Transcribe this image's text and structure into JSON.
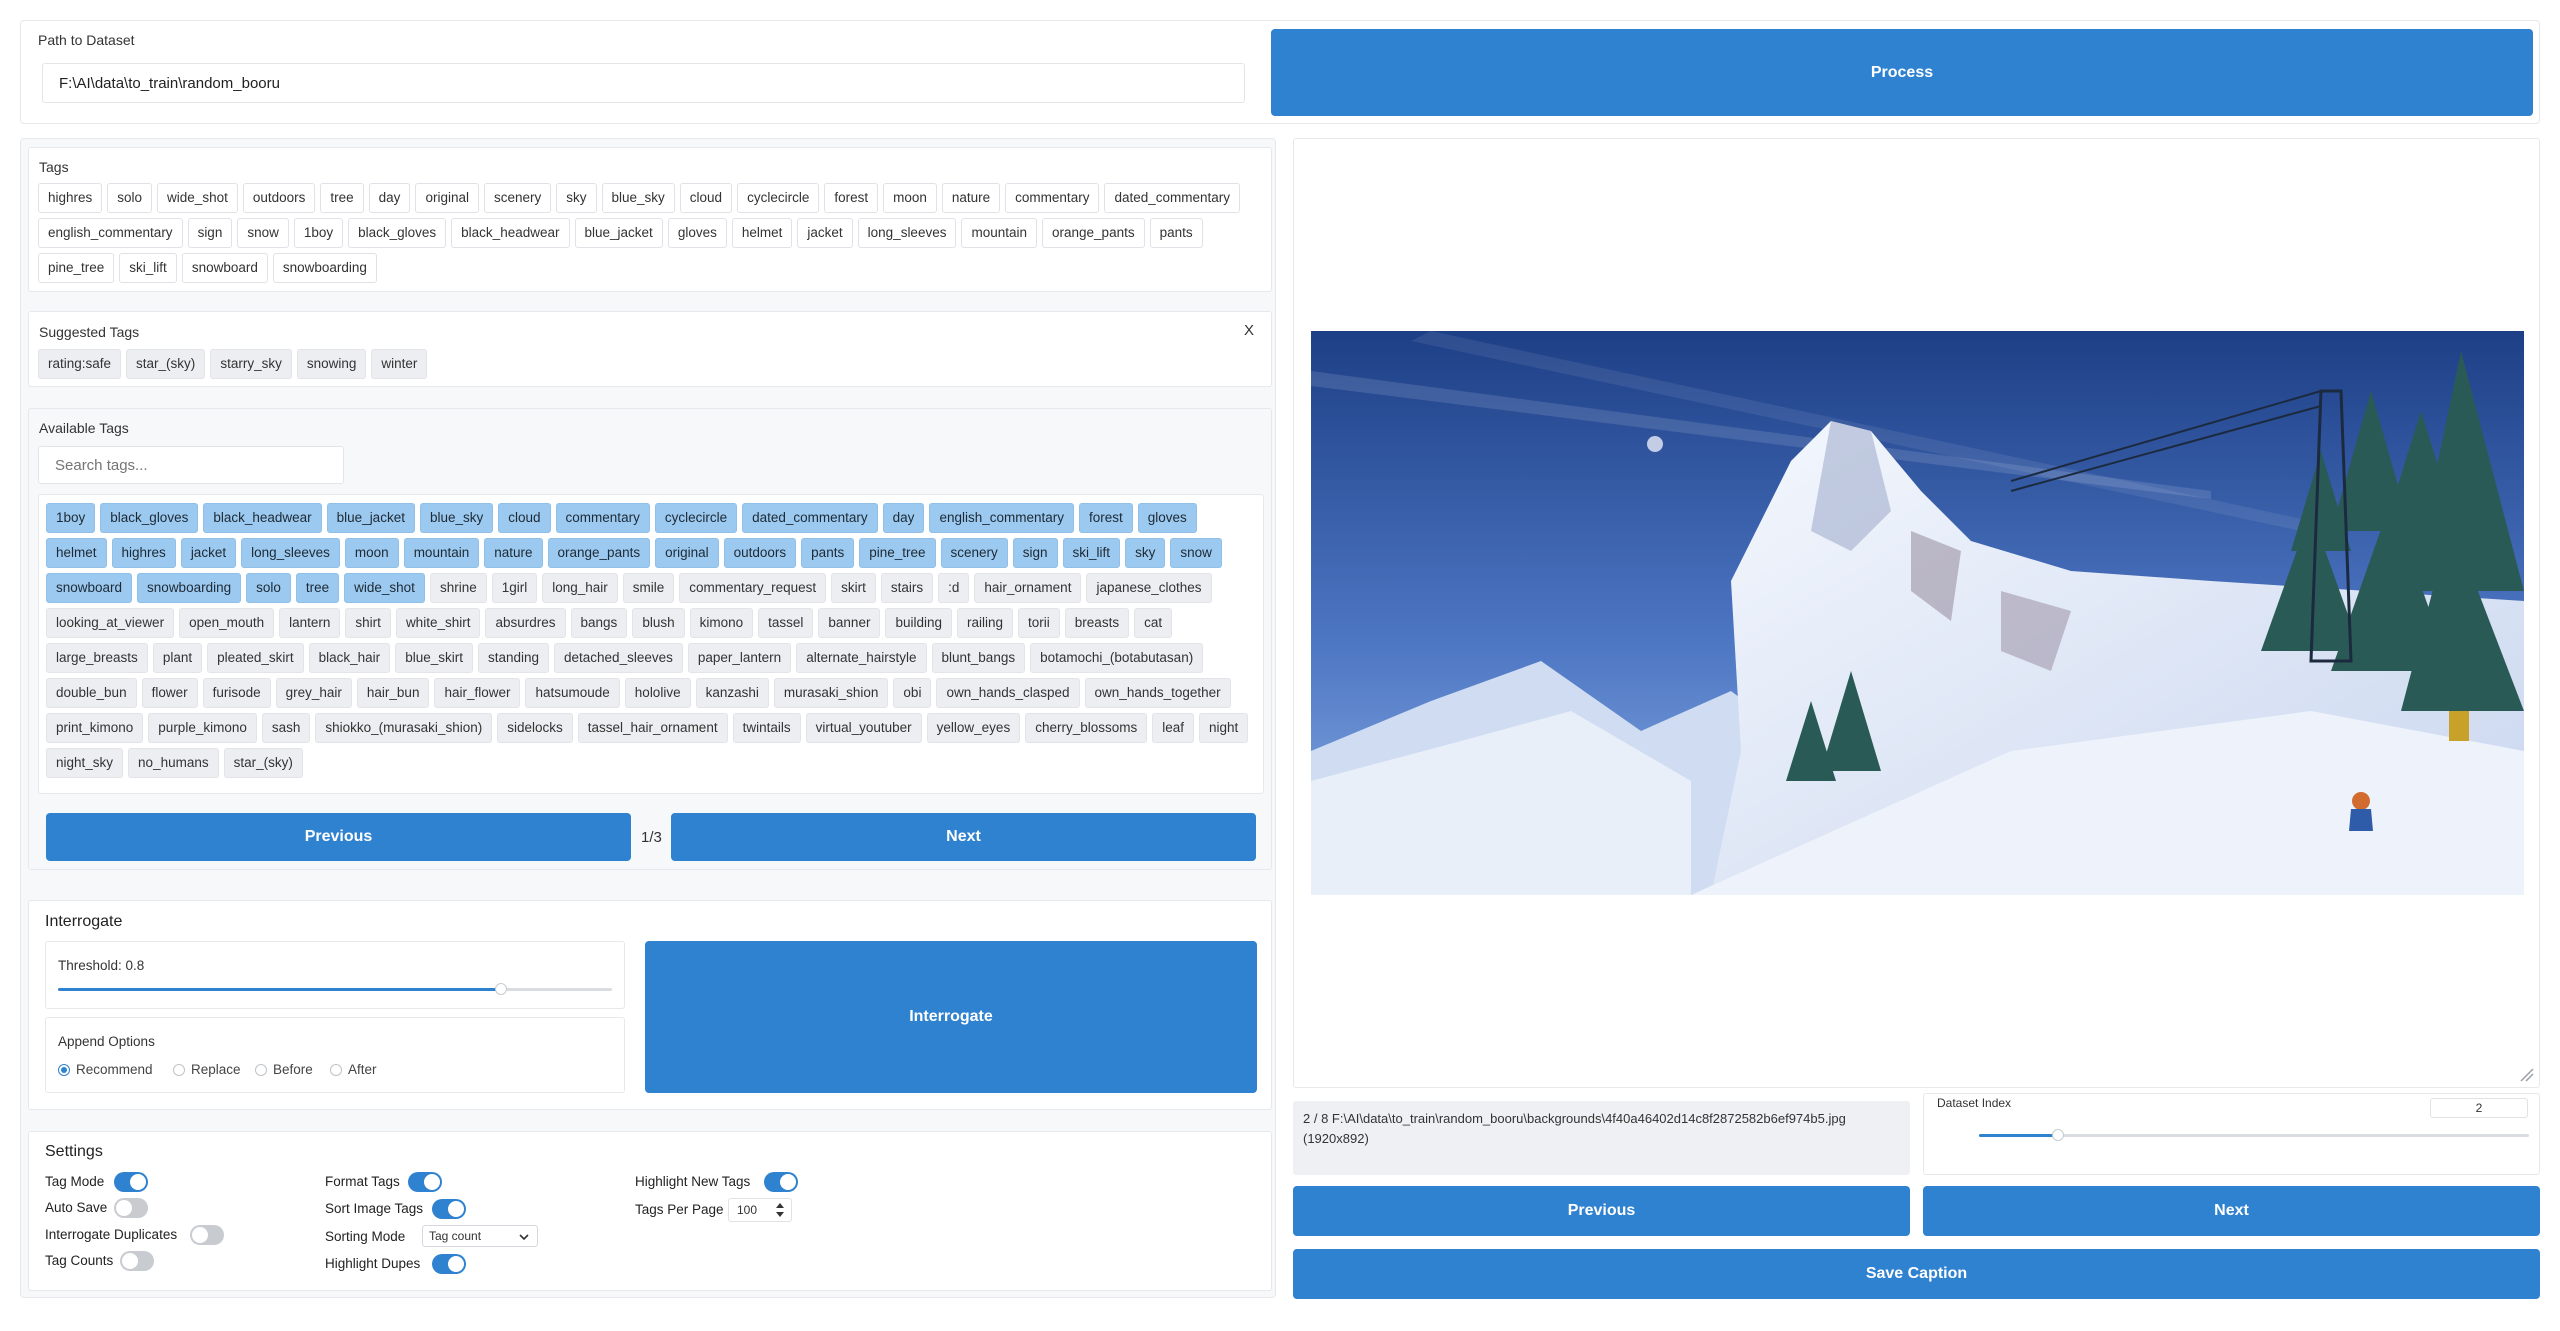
{
  "dataset": {
    "path_label": "Path to Dataset",
    "path_value": "F:\\AI\\data\\to_train\\random_booru",
    "process_label": "Process"
  },
  "tags": {
    "heading": "Tags",
    "items": [
      "highres",
      "solo",
      "wide_shot",
      "outdoors",
      "tree",
      "day",
      "original",
      "scenery",
      "sky",
      "blue_sky",
      "cloud",
      "cyclecircle",
      "forest",
      "moon",
      "nature",
      "commentary",
      "dated_commentary",
      "english_commentary",
      "sign",
      "snow",
      "1boy",
      "black_gloves",
      "black_headwear",
      "blue_jacket",
      "gloves",
      "helmet",
      "jacket",
      "long_sleeves",
      "mountain",
      "orange_pants",
      "pants",
      "pine_tree",
      "ski_lift",
      "snowboard",
      "snowboarding"
    ]
  },
  "suggested": {
    "heading": "Suggested Tags",
    "close_label": "X",
    "items": [
      "rating:safe",
      "star_(sky)",
      "starry_sky",
      "snowing",
      "winter"
    ]
  },
  "available": {
    "heading": "Available Tags",
    "search_placeholder": "Search tags...",
    "selected_items": [
      "1boy",
      "black_gloves",
      "black_headwear",
      "blue_jacket",
      "blue_sky",
      "cloud",
      "commentary",
      "cyclecircle",
      "dated_commentary",
      "day",
      "english_commentary",
      "forest",
      "gloves",
      "helmet",
      "highres",
      "jacket",
      "long_sleeves",
      "moon",
      "mountain",
      "nature",
      "orange_pants",
      "original",
      "outdoors",
      "pants",
      "pine_tree",
      "scenery",
      "sign",
      "ski_lift",
      "sky",
      "snow",
      "snowboard",
      "snowboarding",
      "solo",
      "tree",
      "wide_shot"
    ],
    "other_items": [
      "shrine",
      "1girl",
      "long_hair",
      "smile",
      "commentary_request",
      "skirt",
      "stairs",
      ":d",
      "hair_ornament",
      "japanese_clothes",
      "looking_at_viewer",
      "open_mouth",
      "lantern",
      "shirt",
      "white_shirt",
      "absurdres",
      "bangs",
      "blush",
      "kimono",
      "tassel",
      "banner",
      "building",
      "railing",
      "torii",
      "breasts",
      "cat",
      "large_breasts",
      "plant",
      "pleated_skirt",
      "black_hair",
      "blue_skirt",
      "standing",
      "detached_sleeves",
      "paper_lantern",
      "alternate_hairstyle",
      "blunt_bangs",
      "botamochi_(botabutasan)",
      "double_bun",
      "flower",
      "furisode",
      "grey_hair",
      "hair_bun",
      "hair_flower",
      "hatsumoude",
      "hololive",
      "kanzashi",
      "murasaki_shion",
      "obi",
      "own_hands_clasped",
      "own_hands_together",
      "print_kimono",
      "purple_kimono",
      "sash",
      "shiokko_(murasaki_shion)",
      "sidelocks",
      "tassel_hair_ornament",
      "twintails",
      "virtual_youtuber",
      "yellow_eyes",
      "cherry_blossoms",
      "leaf",
      "night",
      "night_sky",
      "no_humans",
      "star_(sky)"
    ],
    "prev_label": "Previous",
    "next_label": "Next",
    "page": "1/3"
  },
  "interrogate": {
    "heading": "Interrogate",
    "threshold_label": "Threshold: 0.8",
    "threshold_value": 0.8,
    "append_label": "Append Options",
    "options": [
      "Recommend",
      "Replace",
      "Before",
      "After"
    ],
    "selected_option": "Recommend",
    "button_label": "Interrogate"
  },
  "settings": {
    "heading": "Settings",
    "tag_mode": "Tag Mode",
    "auto_save": "Auto Save",
    "interrogate_duplicates": "Interrogate Duplicates",
    "tag_counts": "Tag Counts",
    "format_tags": "Format Tags",
    "sort_image_tags": "Sort Image Tags",
    "sorting_mode": "Sorting Mode",
    "sorting_mode_value": "Tag count",
    "highlight_dupes": "Highlight Dupes",
    "highlight_new_tags": "Highlight New Tags",
    "tags_per_page": "Tags Per Page",
    "tags_per_page_value": "100"
  },
  "image_info": {
    "caption_line1": "2 / 8 F:\\AI\\data\\to_train\\random_booru\\backgrounds\\4f40a46402d14c8f2872582b6ef974b5.jpg",
    "caption_line2": "(1920x892)",
    "dataset_index_label": "Dataset Index",
    "dataset_index_value": "2",
    "dataset_index_fraction": 0.143
  },
  "nav": {
    "prev_label": "Previous",
    "next_label": "Next",
    "save_label": "Save Caption"
  },
  "colors": {
    "accent": "#2f82cf",
    "selected_tag": "#9cc9ef"
  }
}
